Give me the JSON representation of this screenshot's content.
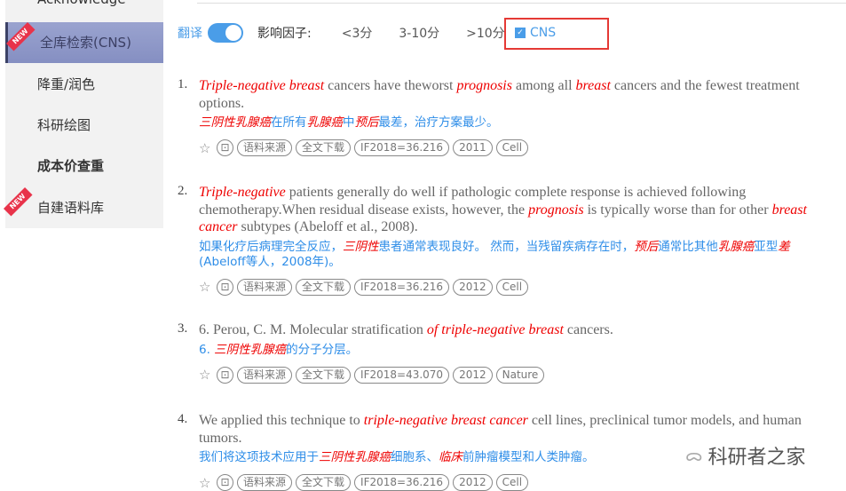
{
  "sidebar": {
    "items": [
      {
        "label": "Acknowledge"
      },
      {
        "label": "全库检索(CNS)",
        "active": true,
        "badge": "NEW"
      },
      {
        "label": "降重/润色"
      },
      {
        "label": "科研绘图"
      },
      {
        "label": "成本价查重",
        "bold": true
      },
      {
        "label": "自建语料库",
        "badge": "NEW"
      }
    ]
  },
  "filters": {
    "translate_label": "翻译",
    "translate_on": true,
    "impact_label": "影响因子:",
    "options": [
      "<3分",
      "3-10分",
      ">10分"
    ],
    "cns_label": "CNS",
    "cns_checked": true
  },
  "results": [
    {
      "num": "1.",
      "en": [
        {
          "t": "Triple-negative breast",
          "hl": true
        },
        {
          "t": " cancers have theworst "
        },
        {
          "t": "prognosis",
          "hl": true
        },
        {
          "t": " among all "
        },
        {
          "t": "breast",
          "hl": true
        },
        {
          "t": " cancers and the fewest treatment options."
        }
      ],
      "zh": [
        {
          "t": "三阴性乳腺癌",
          "hl": true
        },
        {
          "t": "在所有"
        },
        {
          "t": "乳腺癌",
          "hl": true
        },
        {
          "t": "中"
        },
        {
          "t": "预后",
          "hl": true
        },
        {
          "t": "最差，治疗方案最少。"
        }
      ],
      "tags": [
        "语料来源",
        "全文下载",
        "IF2018=36.216",
        "2011",
        "Cell"
      ]
    },
    {
      "num": "2.",
      "en": [
        {
          "t": "Triple-negative",
          "hl": true
        },
        {
          "t": " patients generally do well if pathologic complete response is achieved following chemotherapy.When residual disease exists, however, the "
        },
        {
          "t": "prognosis",
          "hl": true
        },
        {
          "t": " is typically worse than for other "
        },
        {
          "t": "breast cancer",
          "hl": true
        },
        {
          "t": " subtypes (Abeloff et al., 2008)."
        }
      ],
      "zh": [
        {
          "t": "如果化疗后病理完全反应，"
        },
        {
          "t": "三阴性",
          "hl": true
        },
        {
          "t": "患者通常表现良好。 然而，当残留疾病存在时，"
        },
        {
          "t": "预后",
          "hl": true
        },
        {
          "t": "通常比其他"
        },
        {
          "t": "乳腺癌",
          "hl": true
        },
        {
          "t": "亚型"
        },
        {
          "t": "差",
          "hl": true
        },
        {
          "t": "(Abeloff等人，2008年)。"
        }
      ],
      "tags": [
        "语料来源",
        "全文下载",
        "IF2018=36.216",
        "2012",
        "Cell"
      ]
    },
    {
      "num": "3.",
      "en": [
        {
          "t": "6. Perou, C. M. Molecular stratification "
        },
        {
          "t": "of triple-negative breast",
          "hl": true
        },
        {
          "t": " cancers."
        }
      ],
      "zh": [
        {
          "t": "6. "
        },
        {
          "t": "三阴性乳腺癌",
          "hl": true
        },
        {
          "t": "的分子分层。"
        }
      ],
      "tags": [
        "语料来源",
        "全文下载",
        "IF2018=43.070",
        "2012",
        "Nature"
      ]
    },
    {
      "num": "4.",
      "en": [
        {
          "t": "We applied this technique to "
        },
        {
          "t": "triple-negative breast cancer",
          "hl": true
        },
        {
          "t": " cell lines, preclinical tumor models, and human tumors."
        }
      ],
      "zh": [
        {
          "t": "我们将这项技术应用于"
        },
        {
          "t": "三阴性乳腺癌",
          "hl": true
        },
        {
          "t": "细胞系、"
        },
        {
          "t": "临床",
          "hl": true
        },
        {
          "t": "前肿瘤模型和人类肿瘤。"
        }
      ],
      "tags": [
        "语料来源",
        "全文下载",
        "IF2018=36.216",
        "2012",
        "Cell"
      ]
    }
  ],
  "watermark": "科研者之家"
}
